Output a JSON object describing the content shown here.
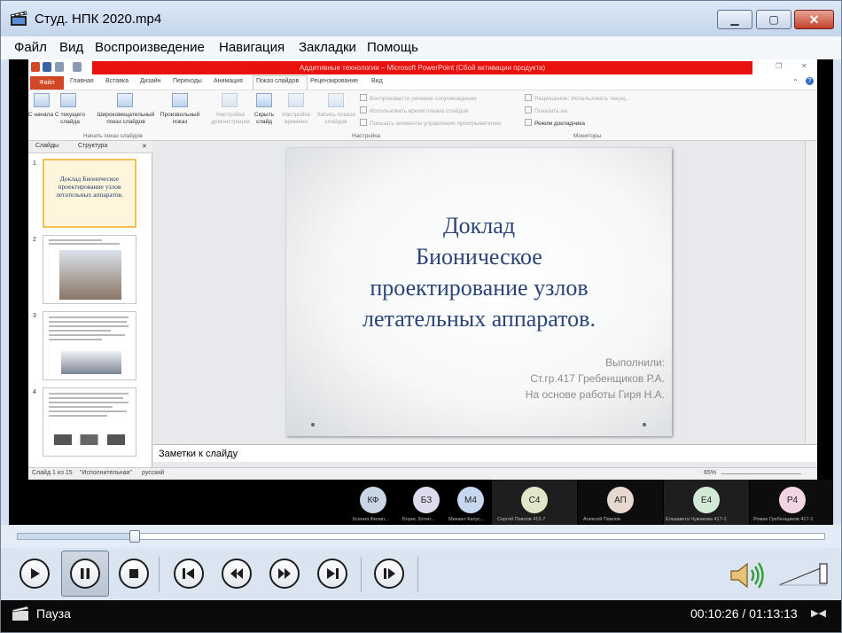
{
  "window": {
    "title": "Студ. НПК 2020.mp4"
  },
  "menu": [
    "Файл",
    "Вид",
    "Воспроизведение",
    "Навигация",
    "Закладки",
    "Помощь"
  ],
  "powerpoint": {
    "title": "Аддитивные технологии – Microsoft PowerPoint (Сбой активации продукта)",
    "tabs": [
      "Файл",
      "Главная",
      "Вставка",
      "Дизайн",
      "Переходы",
      "Анимация",
      "Показ слайдов",
      "Рецензирование",
      "Вид"
    ],
    "ribbon": {
      "from_start": "С начала",
      "from_current": "С текущего слайда",
      "broadcast": "Широковещательный показ слайдов",
      "custom": "Произвольный показ",
      "group_start": "Начать показ слайдов",
      "setup": "Настройка демонстрации",
      "hide": "Скрыть слайд",
      "timing": "Настройка времени",
      "record": "Запись показа слайдов",
      "chk_narration": "Воспроизвести речевое сопровождение",
      "chk_timings": "Использовать время показа слайдов",
      "chk_media": "Показать элементы управления проигрывателем",
      "group_setup": "Настройка",
      "resolution": "Разрешение: Использовать текущ...",
      "show_on": "Показать на:",
      "presenter": "Режим докладчика",
      "group_monitors": "Мониторы"
    },
    "panel_tabs": [
      "Слайды",
      "Структура"
    ],
    "thumbnails": [
      {
        "num": "1",
        "text": "Доклад Бионическое проектирование узлов летательных аппаратов."
      },
      {
        "num": "2"
      },
      {
        "num": "3"
      },
      {
        "num": "4"
      }
    ],
    "slide": {
      "title_lines": [
        "Доклад",
        "Бионическое",
        "проектирование узлов",
        "летательных аппаратов."
      ],
      "sub_lines": [
        "Выполнили:",
        "Ст.гр.417 Гребенщиков Р.А.",
        "На основе работы Гиря Н.А."
      ]
    },
    "notes_placeholder": "Заметки к слайду",
    "status": {
      "slide": "Слайд 1 из 15",
      "theme": "\"Исполнительная\"",
      "lang": "русский",
      "zoom": "65%"
    }
  },
  "participants": [
    {
      "initials": "КФ",
      "name": "Ксения Филип...",
      "color": "#c9d6e6"
    },
    {
      "initials": "БЗ",
      "name": "Борис Зотин...",
      "color": "#dcdcee"
    },
    {
      "initials": "М4",
      "name": "Михаил Капус...",
      "color": "#c6d7ee"
    },
    {
      "initials": "С4",
      "name": "Сергей Павлов 415-7",
      "color": "#dfe6c9"
    },
    {
      "initials": "АП",
      "name": "Алексей Павлов",
      "color": "#e7d9cf"
    },
    {
      "initials": "Е4",
      "name": "Елизавета Чумакова 417-1",
      "color": "#d3e9d7"
    },
    {
      "initials": "Р4",
      "name": "Роман Гребенщиков 417-1",
      "color": "#f0d6e2"
    }
  ],
  "player": {
    "progress": 0.1456,
    "state": "Пауза",
    "time": "00:10:26 / 01:13:13",
    "volume": 1.0,
    "controls": [
      "play",
      "pause",
      "stop",
      "skip-back",
      "rewind",
      "fast-forward",
      "skip-forward",
      "frame-step"
    ]
  }
}
